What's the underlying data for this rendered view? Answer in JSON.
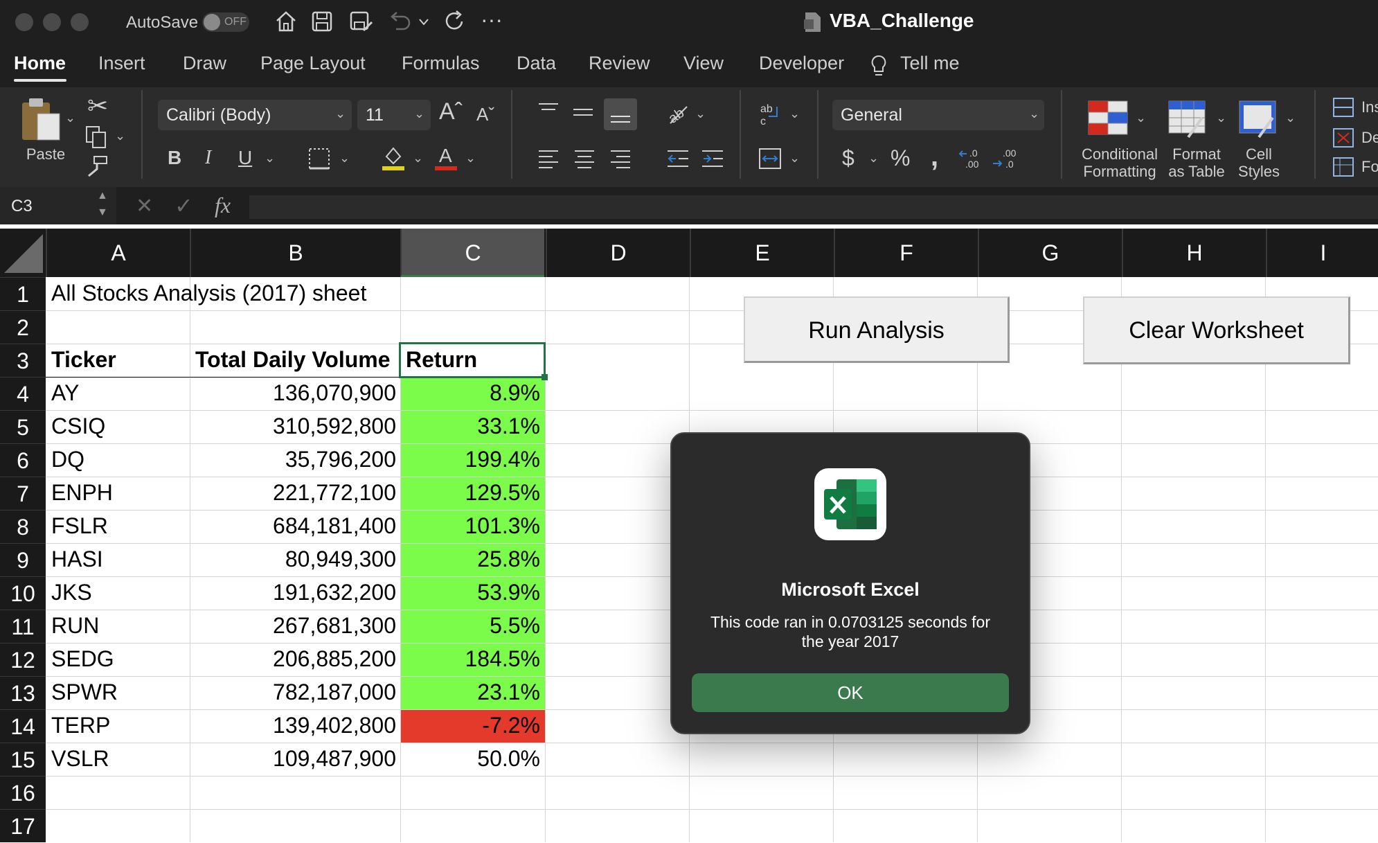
{
  "app": {
    "autosave_label": "AutoSave",
    "autosave_state": "OFF",
    "window_title": "VBA_Challenge"
  },
  "tabs": [
    "Home",
    "Insert",
    "Draw",
    "Page Layout",
    "Formulas",
    "Data",
    "Review",
    "View",
    "Developer",
    "Tell me"
  ],
  "ribbon": {
    "paste_label": "Paste",
    "font_name": "Calibri (Body)",
    "font_size": "11",
    "number_format": "General",
    "conditional_formatting_label": [
      "Conditional",
      "Formatting"
    ],
    "format_as_table_label": [
      "Format",
      "as Table"
    ],
    "cell_styles_label": [
      "Cell",
      "Styles"
    ],
    "cells_group_labels": [
      "Ins",
      "De",
      "Fo"
    ]
  },
  "formula_bar": {
    "name_box": "C3",
    "fx": "fx",
    "value": ""
  },
  "sheet": {
    "columns": [
      "A",
      "B",
      "C",
      "D",
      "E",
      "F",
      "G",
      "H",
      "I"
    ],
    "selected_column": "C",
    "rows": [
      "1",
      "2",
      "3",
      "4",
      "5",
      "6",
      "7",
      "8",
      "9",
      "10",
      "11",
      "12",
      "13",
      "14",
      "15",
      "16",
      "17"
    ],
    "title": "All Stocks Analysis (2017) sheet",
    "headers": [
      "Ticker",
      "Total Daily Volume",
      "Return"
    ],
    "data": [
      [
        "AY",
        "136,070,900",
        "8.9%"
      ],
      [
        "CSIQ",
        "310,592,800",
        "33.1%"
      ],
      [
        "DQ",
        "35,796,200",
        "199.4%"
      ],
      [
        "ENPH",
        "221,772,100",
        "129.5%"
      ],
      [
        "FSLR",
        "684,181,400",
        "101.3%"
      ],
      [
        "HASI",
        "80,949,300",
        "25.8%"
      ],
      [
        "JKS",
        "191,632,200",
        "53.9%"
      ],
      [
        "RUN",
        "267,681,300",
        "5.5%"
      ],
      [
        "SEDG",
        "206,885,200",
        "184.5%"
      ],
      [
        "SPWR",
        "782,187,000",
        "23.1%"
      ],
      [
        "TERP",
        "139,402,800",
        "-7.2%"
      ],
      [
        "VSLR",
        "109,487,900",
        "50.0%"
      ]
    ],
    "positive_color": "#7bfb4a",
    "negative_color": "#e33a2b"
  },
  "buttons": {
    "run_analysis": "Run Analysis",
    "clear_worksheet": "Clear Worksheet"
  },
  "dialog": {
    "title": "Microsoft Excel",
    "message": "This code ran in 0.0703125 seconds for the year 2017",
    "ok": "OK"
  }
}
